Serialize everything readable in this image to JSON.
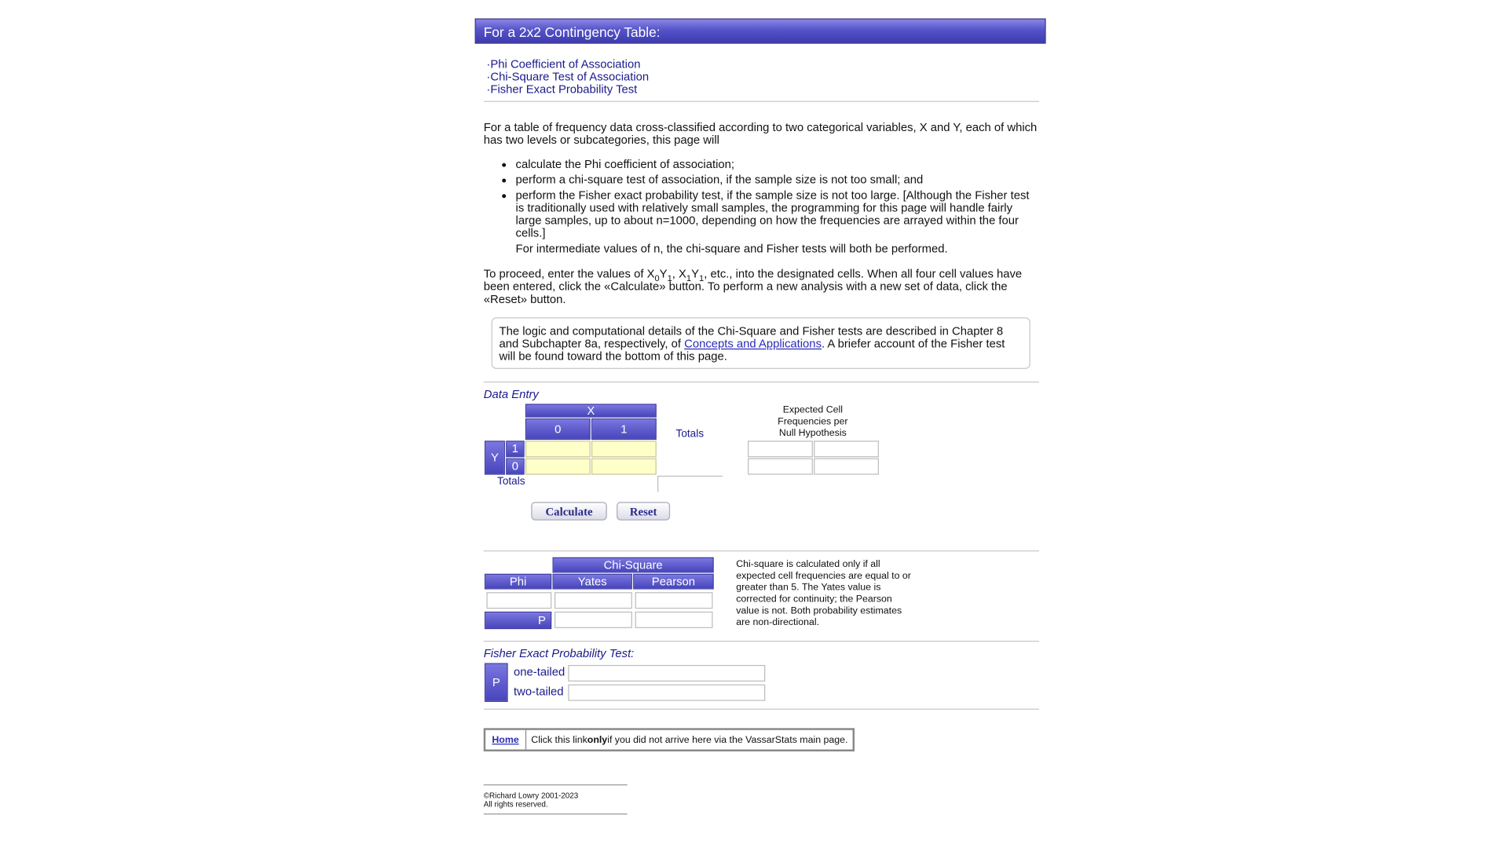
{
  "banner": {
    "title": "For a 2x2 Contingency Table:"
  },
  "nav": {
    "bullet": "·",
    "links": [
      "Phi Coefficient of Association",
      "Chi-Square Test of Association",
      "Fisher Exact Probability Test"
    ]
  },
  "intro": {
    "paragraph": "For a table of frequency data cross-classified according to two categorical variables, X and Y, each of which has two levels or subcategories, this page will",
    "bullets": [
      "calculate the Phi coefficient of association;",
      "perform a chi-square test of association, if the sample size is not too small; and",
      "perform the Fisher exact probability test, if the sample size is not too large. [Although the Fisher test is traditionally used with relatively small samples, the programming for this page will handle fairly large samples, up to about n=1000, depending on how the frequencies are arrayed within the four cells.]"
    ],
    "bullet_followup": "For intermediate values of n, the chi-square and Fisher tests will both be performed.",
    "proceed_a": "To proceed, enter the values of X",
    "proceed_b": ", etc., into the designated cells. When all four cell values have been entered, click the «Calculate» button. To perform a new analysis with a new set of data, click the «Reset» button."
  },
  "note": {
    "text_before": "The logic and computational details of the Chi-Square and Fisher tests are described in Chapter 8 and Subchapter 8a, respectively, of ",
    "link": "Concepts and Applications",
    "text_after": ". A briefer account of the Fisher test will be found toward the bottom of this page."
  },
  "data_entry": {
    "title": "Data Entry",
    "x_header": "X",
    "x_levels": [
      "0",
      "1"
    ],
    "y_header": "Y",
    "y_levels": [
      "1",
      "0"
    ],
    "totals_col": "Totals",
    "totals_row": "Totals",
    "expected_title": "Expected Cell Frequencies per Null Hypothesis",
    "calculate_label": "Calculate",
    "reset_label": "Reset"
  },
  "results": {
    "chi_square_header": "Chi-Square",
    "phi_header": "Phi",
    "yates_header": "Yates",
    "pearson_header": "Pearson",
    "p_label": "P",
    "explanation": "Chi-square is calculated only if all expected cell frequencies are equal to or greater than 5. The Yates value is corrected for continuity; the Pearson value is not. Both probability estimates are non-directional."
  },
  "fisher": {
    "title": "Fisher Exact Probability Test:",
    "p_label": "P",
    "one_tailed": "one-tailed",
    "two_tailed": "two-tailed"
  },
  "home": {
    "link": "Home",
    "text_a": "Click this link ",
    "text_bold": "only",
    "text_b": " if you did not arrive here via the VassarStats main page."
  },
  "footer": {
    "copyright": "©Richard Lowry 2001-2023",
    "rights": "All rights reserved."
  }
}
